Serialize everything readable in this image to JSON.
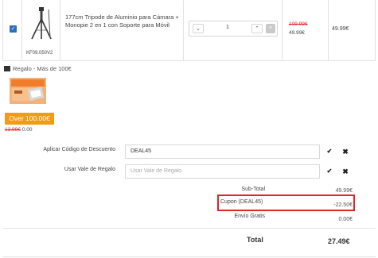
{
  "cart_item": {
    "checked": true,
    "sku": "KF09.050V2",
    "name": "177cm Tripode de Aluminio para Cámara + Monopie 2 en 1 con Soporte para Móvil",
    "quantity": "1",
    "old_price": "109.99€",
    "new_price": "49.99€",
    "line_total": "49.99€",
    "icons": {
      "checkbox": "check-icon",
      "minus": "chevron-down-icon",
      "plus": "chevron-up-icon",
      "remove": "close-icon"
    }
  },
  "gift": {
    "title": "Regalo - Más de 100€",
    "button_label": "Over 100.00€",
    "old_price": "13.99€",
    "new_price": "0.00",
    "button_color": "#f39c12"
  },
  "discount": {
    "label": "Aplicar Código de Descuento",
    "value": "DEAL45"
  },
  "voucher": {
    "label": "Usar Vale de Regalo",
    "placeholder": "Usar Vale de Regalo"
  },
  "actions": {
    "apply_glyph": "✔",
    "remove_glyph": "✖"
  },
  "totals": {
    "subtotal_label": "Sub-Total",
    "subtotal_value": "49.99€",
    "coupon_label": "Cupon (DEAL45)",
    "coupon_value": "-22.50€",
    "shipping_label": "Envío Gratis",
    "shipping_value": "0.00€",
    "total_label": "Total",
    "total_value": "27.49€"
  },
  "colors": {
    "accent_red": "#e02525",
    "price_red": "#e4262e",
    "checkbox_blue": "#2a6ebd"
  }
}
